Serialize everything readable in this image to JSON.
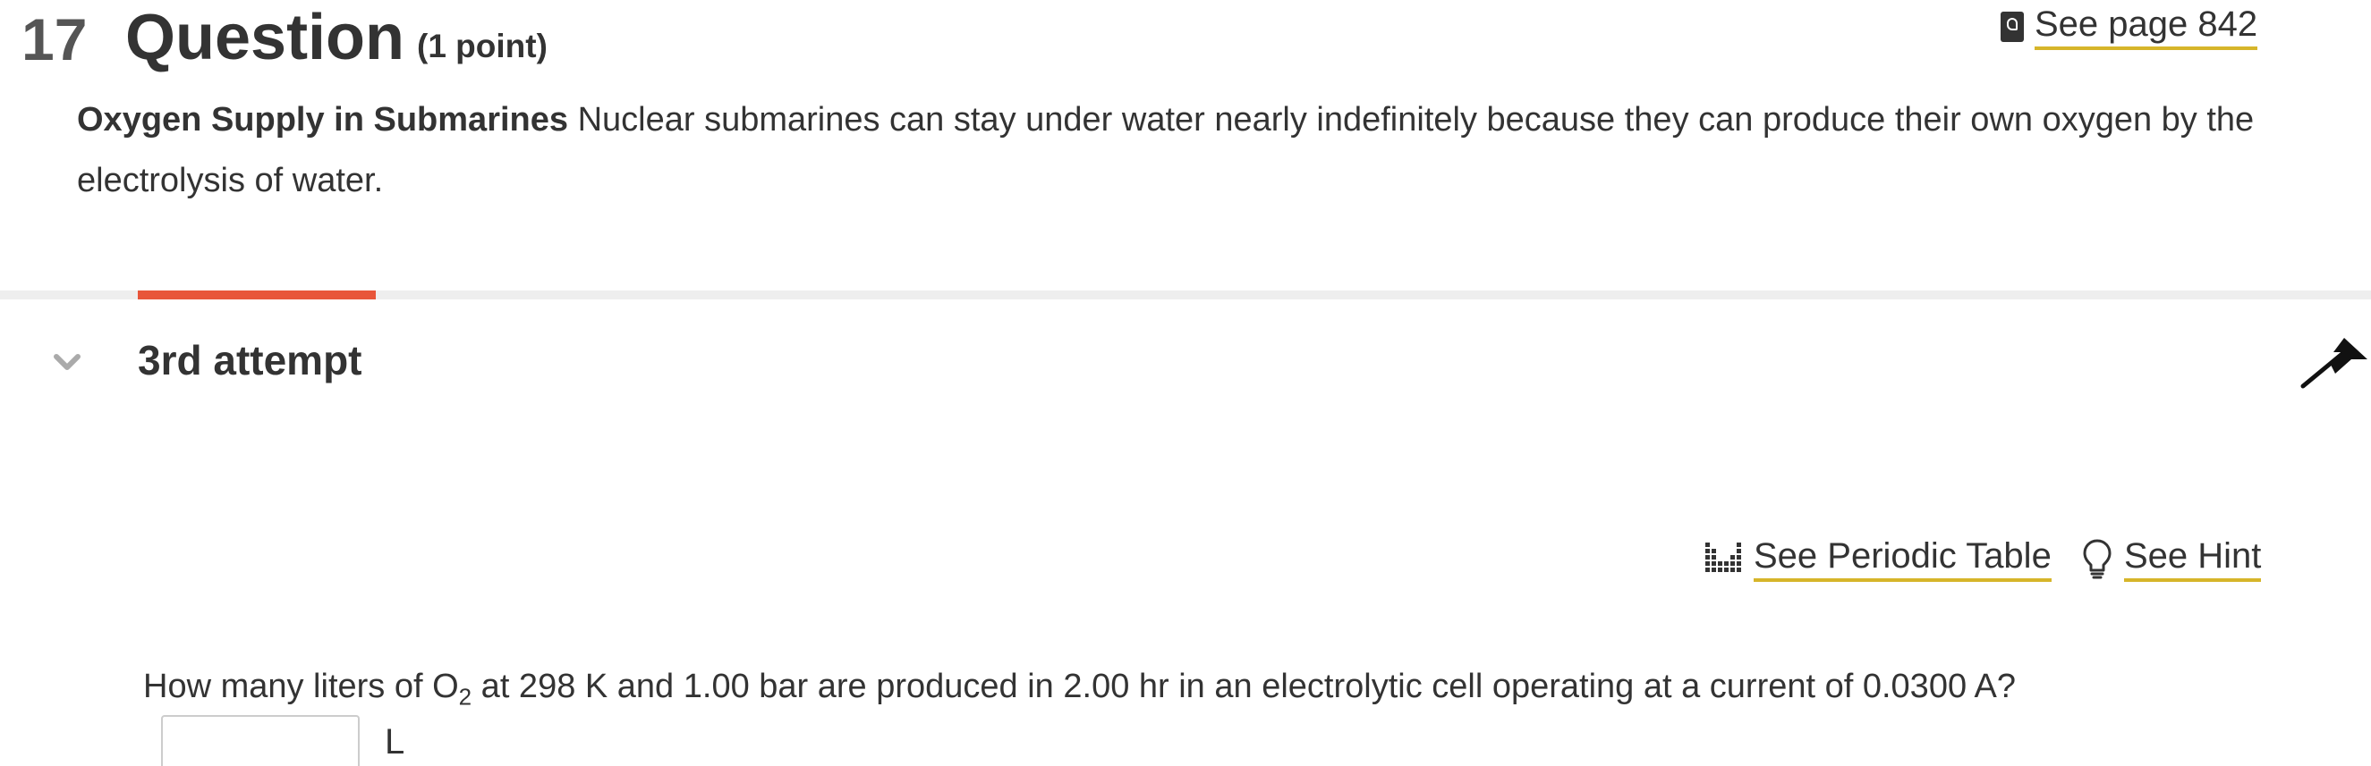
{
  "header": {
    "number": "17",
    "title": "Question",
    "points": "(1 point)",
    "see_page": "See page 842"
  },
  "intro": {
    "bold_title": "Oxygen Supply in Submarines",
    "text": " Nuclear submarines can stay under water nearly indefinitely because they can produce their own oxygen by the electrolysis of water."
  },
  "attempt": {
    "label": "3rd attempt"
  },
  "tools": {
    "periodic_table": "See Periodic Table",
    "hint": "See Hint"
  },
  "question": {
    "before_sub": "How many liters of O",
    "subscript": "2",
    "after_sub": " at 298 K and 1.00 bar are produced in 2.00 hr in an electrolytic cell operating at a current of 0.0300 A?",
    "answer_value": "",
    "unit": "L"
  },
  "colors": {
    "accent_tab": "#e8553a",
    "link_underline": "#d6b52a",
    "text": "#333333"
  },
  "icons": {
    "see_page": "ebook-icon",
    "periodic_table": "periodic-table-icon",
    "hint": "lightbulb-icon",
    "attempt_toggle": "chevron-down-icon",
    "collapse": "arrow-up-icon"
  }
}
